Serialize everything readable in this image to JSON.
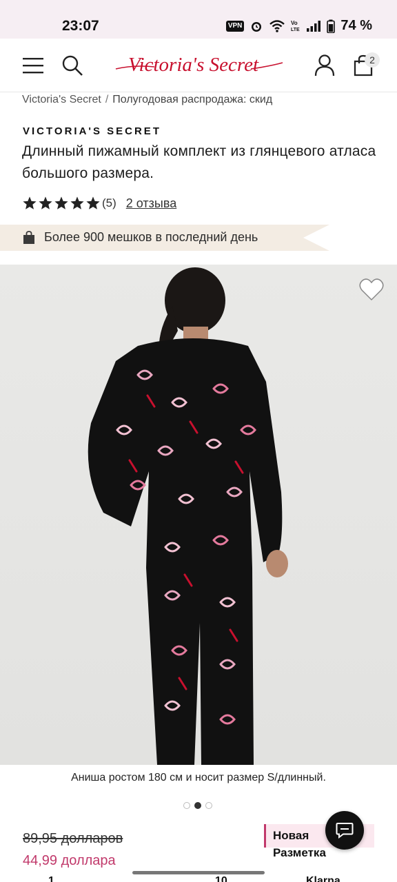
{
  "status_bar": {
    "time": "23:07",
    "vpn": "VPN",
    "battery": "74 %"
  },
  "header": {
    "logo_text": "Victoria's Secret",
    "bag_count": "2"
  },
  "breadcrumb": {
    "home": "Victoria's Secret",
    "separator": "/",
    "current": "Полугодовая распродажа: скид"
  },
  "product": {
    "brand": "VICTORIA'S SECRET",
    "title": "Длинный пижамный комплект из глянцевого атласа большого размера.",
    "rating_value": 5,
    "rating_count": "(5)",
    "reviews_link": "2 отзыва",
    "promo": "Более 900 мешков в последний день",
    "image_caption": "Аниша ростом 180 см и носит размер S/длинный.",
    "old_price": "89,95 долларов",
    "new_price": "44,99 доллара",
    "badge_new": "Новая",
    "badge_size": "Разметка"
  },
  "carousel": {
    "total": 3,
    "active": 2
  },
  "bottom_fragments": {
    "left": "1",
    "middle": "10",
    "right": "Klarna"
  },
  "colors": {
    "accent": "#c1396b",
    "status_bar_bg": "#f6eef3",
    "promo_bg": "#f3ece3",
    "image_bg": "#e6e6e4"
  }
}
